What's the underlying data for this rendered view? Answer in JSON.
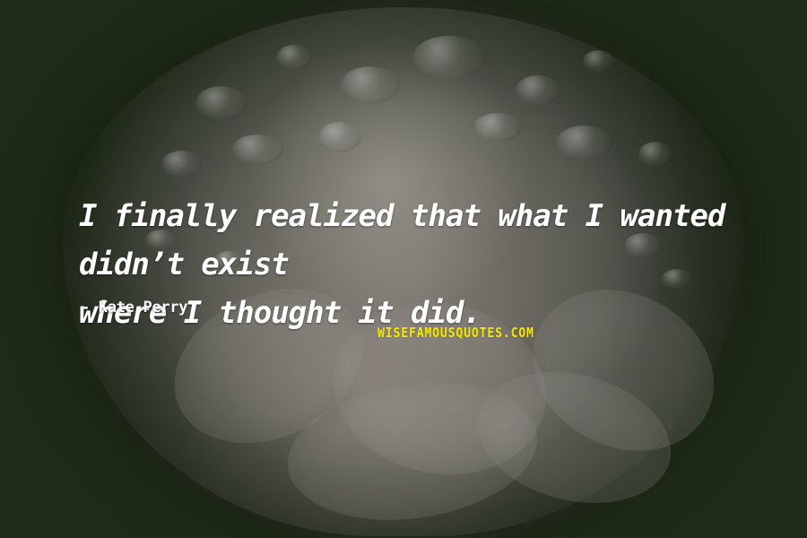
{
  "quote": {
    "line_1": "I finally realized that what I wanted didn’t exist",
    "line_2": "where I thought it did.",
    "author": "- Kate Perry"
  },
  "watermark": {
    "text": "WISEFAMOUSQUOTES.COM"
  }
}
